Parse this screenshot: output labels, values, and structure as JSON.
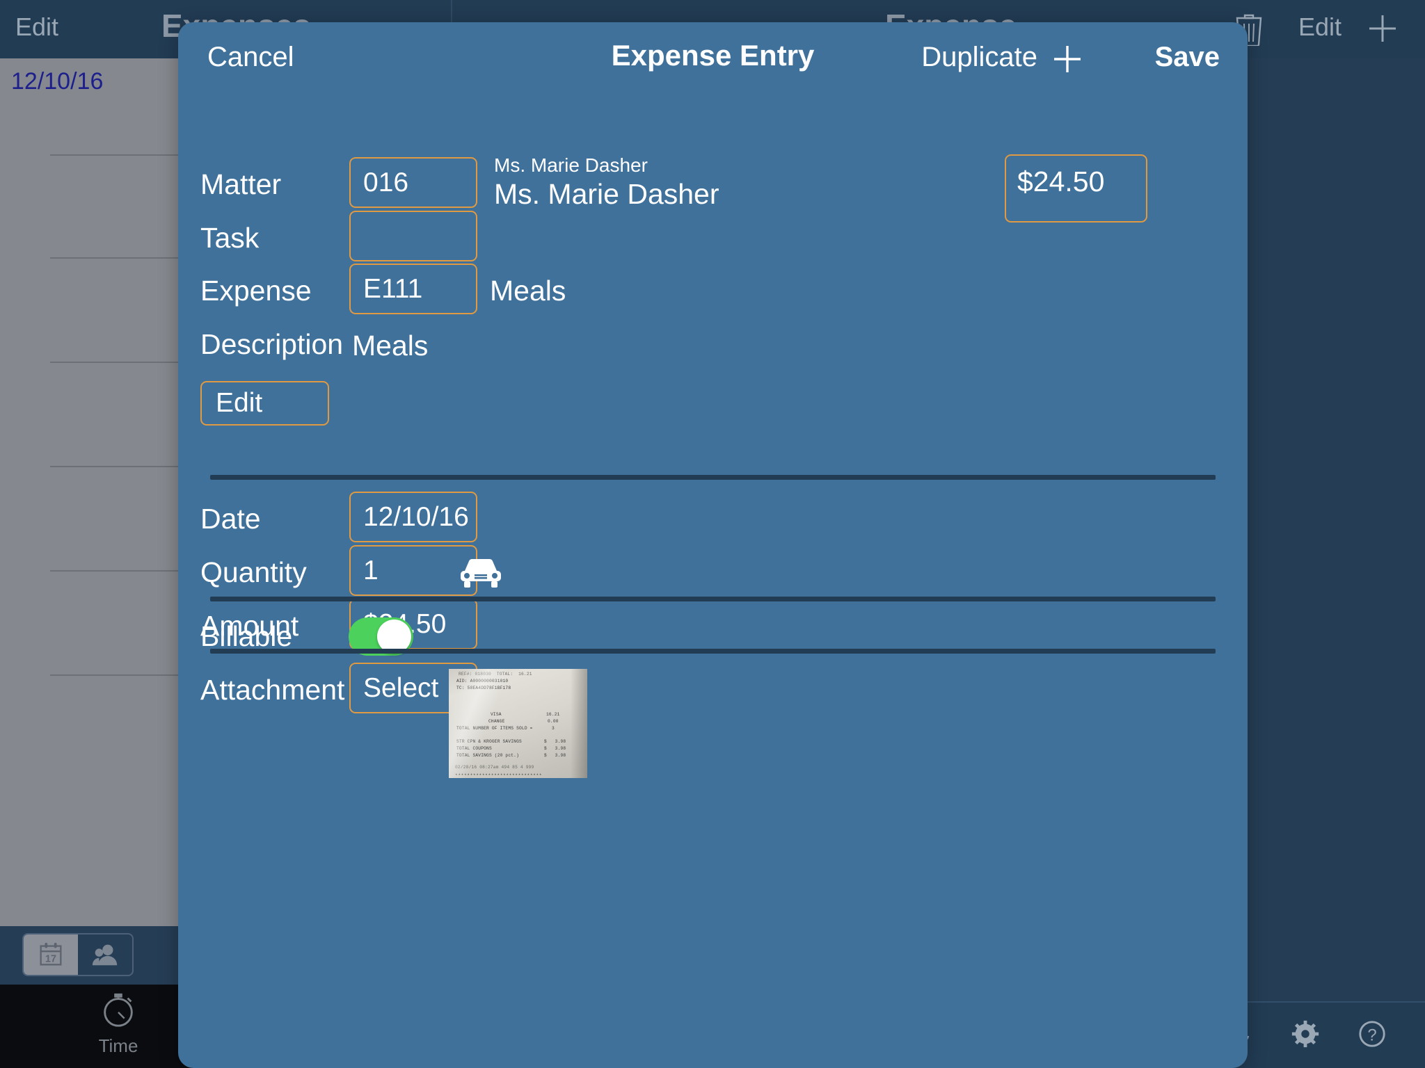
{
  "background": {
    "nav": {
      "edit_left": "Edit",
      "title_left": "Expenses",
      "title_right": "Expense",
      "trash_icon": "trash-icon",
      "edit_right": "Edit",
      "plus_icon": "plus-icon"
    },
    "list": {
      "first_row_date": "12/10/16"
    },
    "segmented": {
      "calendar_icon": "calendar-17-icon",
      "calendar_day": "17",
      "people_icon": "people-icon"
    },
    "tabbar": {
      "time_label": "Time",
      "time_icon": "stopwatch-icon"
    },
    "bottom_tools": {
      "sync_icon": "sync-icon",
      "gear_icon": "gear-icon",
      "help_icon": "help-icon"
    }
  },
  "modal": {
    "header": {
      "cancel": "Cancel",
      "title": "Expense Entry",
      "duplicate": "Duplicate",
      "add_icon": "plus-icon",
      "save": "Save"
    },
    "fields": {
      "matter_label": "Matter",
      "matter_value": "016",
      "matter_client_small": "Ms. Marie Dasher",
      "matter_client_large": "Ms. Marie Dasher",
      "amount_total": "$24.50",
      "task_label": "Task",
      "task_value": "",
      "expense_label": "Expense",
      "expense_value": "E111",
      "expense_name": "Meals",
      "description_label": "Description",
      "description_value": "Meals",
      "edit_button": "Edit",
      "date_label": "Date",
      "date_value": "12/10/16",
      "quantity_label": "Quantity",
      "quantity_value": "1",
      "mileage_icon": "car-icon",
      "amount_label": "Amount",
      "amount_value": "$24.50",
      "billable_label": "Billable",
      "billable_on": true,
      "attachment_label": "Attachment",
      "attachment_button": "Select"
    },
    "receipt": {
      "line_ref": "REF#: 018030  TOTAL:  16.21",
      "line_aid": "AID: A0000000031010",
      "line_tc": "TC: 58EA4DD78F1BF178",
      "line_visa_label": "VISA",
      "line_visa_value": "16.21",
      "line_change_label": "CHANGE",
      "line_change_value": "0.00",
      "line_items_label": "TOTAL NUMBER OF ITEMS SOLD =",
      "line_items_value": "3",
      "line_str_cpn_label": "STR CPN & KROGER SAVINGS",
      "line_str_cpn_value": "$   3.98",
      "line_coupons_label": "TOTAL COUPONS",
      "line_coupons_value": "$   3.98",
      "line_savings_label": "TOTAL SAVINGS (20 pct.)",
      "line_savings_value": "$   3.98",
      "line_timestamp": "02/28/16 08:27am 494 85 4 999",
      "line_stars": "*****************************"
    }
  },
  "colors": {
    "modal_bg": "#40719a",
    "accent_border": "#e09a42",
    "nav_bg": "#223c54",
    "toggle_on": "#4cd25c",
    "list_bg": "#85888e"
  }
}
